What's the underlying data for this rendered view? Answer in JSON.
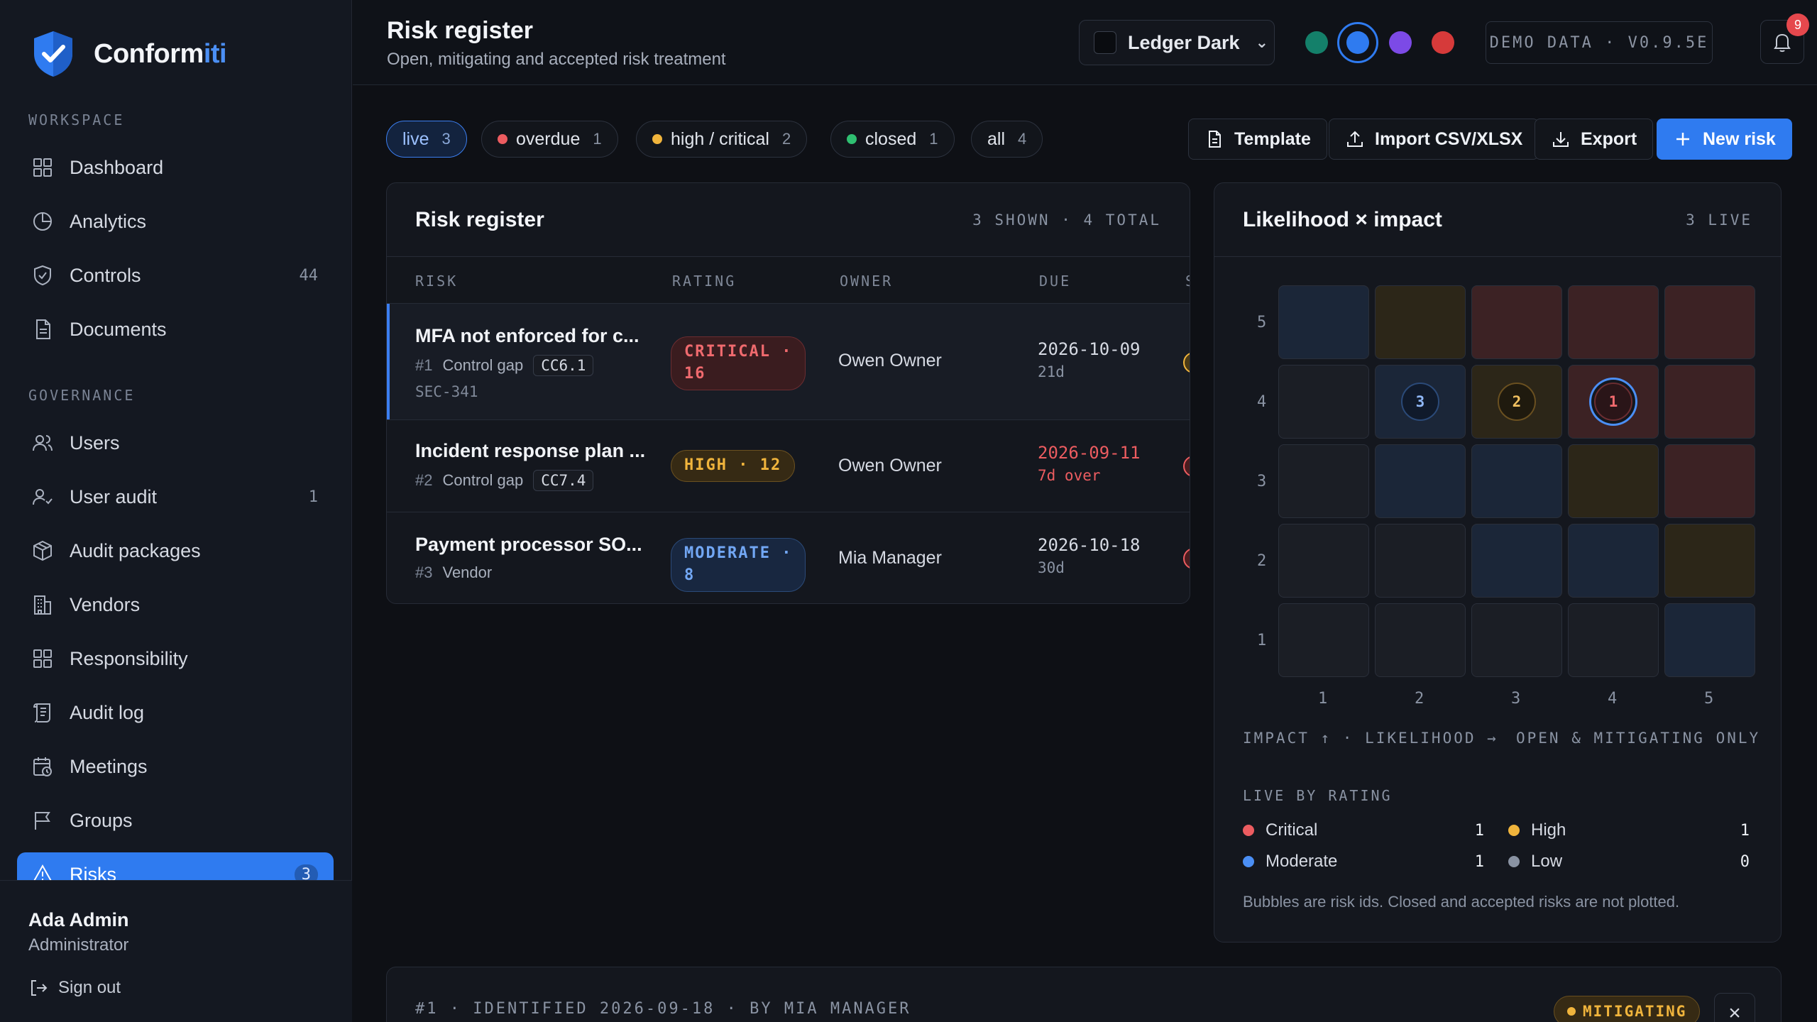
{
  "brand": {
    "name_main": "Conform",
    "name_accent": "iti"
  },
  "sidebar": {
    "workspace_label": "WORKSPACE",
    "governance_label": "GOVERNANCE",
    "workspace_items": [
      {
        "label": "Dashboard",
        "icon": "dashboard-icon",
        "count": ""
      },
      {
        "label": "Analytics",
        "icon": "pie-chart-icon",
        "count": ""
      },
      {
        "label": "Controls",
        "icon": "shield-icon",
        "count": "44"
      },
      {
        "label": "Documents",
        "icon": "document-icon",
        "count": ""
      }
    ],
    "governance_items": [
      {
        "label": "Users",
        "icon": "users-icon",
        "count": ""
      },
      {
        "label": "User audit",
        "icon": "user-check-icon",
        "count": "1"
      },
      {
        "label": "Audit packages",
        "icon": "package-icon",
        "count": ""
      },
      {
        "label": "Vendors",
        "icon": "building-icon",
        "count": ""
      },
      {
        "label": "Responsibility",
        "icon": "grid-icon",
        "count": ""
      },
      {
        "label": "Audit log",
        "icon": "scroll-icon",
        "count": ""
      },
      {
        "label": "Meetings",
        "icon": "calendar-clock-icon",
        "count": ""
      },
      {
        "label": "Groups",
        "icon": "flag-icon",
        "count": ""
      },
      {
        "label": "Risks",
        "icon": "warning-icon",
        "count": "3"
      }
    ],
    "user": {
      "name": "Ada Admin",
      "role": "Administrator",
      "signout": "Sign out"
    }
  },
  "header": {
    "title": "Risk register",
    "subtitle": "Open, mitigating and accepted risk treatment",
    "theme": "Ledger Dark",
    "accent_colors": [
      "#14806a",
      "#2f7bf0",
      "#7c4ae6",
      "#d63a3a"
    ],
    "demo_badge": "DEMO DATA · V0.9.5E",
    "notifications": "9"
  },
  "filters": [
    {
      "label": "live",
      "count": "3",
      "color": "",
      "active": true
    },
    {
      "label": "overdue",
      "count": "1",
      "color": "#ec5c60"
    },
    {
      "label": "high / critical",
      "count": "2",
      "color": "#f0b43c"
    },
    {
      "label": "closed",
      "count": "1",
      "color": "#2fbf71"
    },
    {
      "label": "all",
      "count": "4",
      "color": ""
    }
  ],
  "actions": {
    "template": "Template",
    "import": "Import CSV/XLSX",
    "export": "Export",
    "new_risk": "New risk"
  },
  "register": {
    "title": "Risk register",
    "meta": "3 SHOWN · 4 TOTAL",
    "columns": [
      "RISK",
      "RATING",
      "OWNER",
      "DUE",
      "S"
    ],
    "rows": [
      {
        "title": "MFA not enforced for c...",
        "num": "#1",
        "category": "Control gap",
        "code": "CC6.1",
        "sub": "SEC-341",
        "rating_line1": "CRITICAL ·",
        "rating_line2": "16",
        "rating_class": "critical",
        "owner": "Owen Owner",
        "due": "2026-10-09",
        "due_rel": "21d",
        "over": false,
        "status_color": "#f0b43c"
      },
      {
        "title": "Incident response plan ...",
        "num": "#2",
        "category": "Control gap",
        "code": "CC7.4",
        "sub": "",
        "rating_line1": "HIGH · 12",
        "rating_line2": "",
        "rating_class": "high",
        "owner": "Owen Owner",
        "due": "2026-09-11",
        "due_rel": "7d over",
        "over": true,
        "status_color": "#ec5c60"
      },
      {
        "title": "Payment processor SO...",
        "num": "#3",
        "category": "Vendor",
        "code": "",
        "sub": "",
        "rating_line1": "MODERATE ·",
        "rating_line2": "8",
        "rating_class": "moderate",
        "owner": "Mia Manager",
        "due": "2026-10-18",
        "due_rel": "30d",
        "over": false,
        "status_color": "#ec5c60"
      }
    ]
  },
  "matrix": {
    "title": "Likelihood × impact",
    "meta": "3 LIVE",
    "axis_note_left": "IMPACT ↑ · LIKELIHOOD →",
    "axis_note_right": "OPEN & MITIGATING ONLY",
    "y_labels": [
      "5",
      "4",
      "3",
      "2",
      "1"
    ],
    "x_labels": [
      "1",
      "2",
      "3",
      "4",
      "5"
    ],
    "bubbles": [
      {
        "id": "3",
        "impact": 4,
        "likelihood": 2,
        "level": "moderate"
      },
      {
        "id": "2",
        "impact": 4,
        "likelihood": 3,
        "level": "high"
      },
      {
        "id": "1",
        "impact": 4,
        "likelihood": 4,
        "level": "critical",
        "selected": true
      }
    ],
    "legend_title": "LIVE BY RATING",
    "legend": [
      {
        "label": "Critical",
        "value": "1",
        "color": "#ec5c60"
      },
      {
        "label": "High",
        "value": "1",
        "color": "#f0b43c"
      },
      {
        "label": "Moderate",
        "value": "1",
        "color": "#4b8ff5"
      },
      {
        "label": "Low",
        "value": "0",
        "color": "#8a93a3"
      }
    ],
    "footnote": "Bubbles are risk ids. Closed and accepted risks are not plotted."
  },
  "detail": {
    "meta": "#1 · IDENTIFIED 2026-09-18 · BY MIA MANAGER",
    "status": "MITIGATING"
  }
}
